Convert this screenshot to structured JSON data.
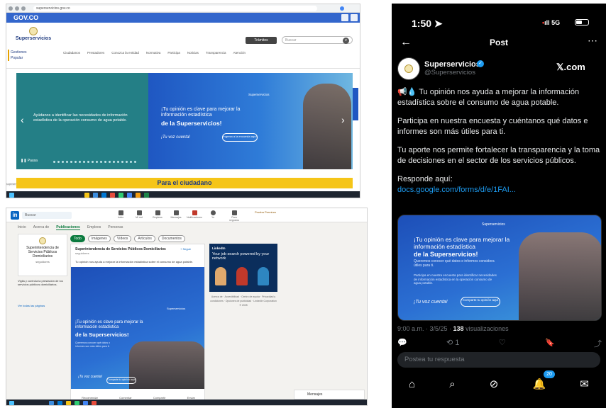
{
  "govco": {
    "url": "superservicios.gov.co",
    "topbar_logo": "GOV.CO",
    "brand": "Superservicios",
    "tramite_btn": "Trámites",
    "search_placeholder": "Buscar",
    "sidenav": [
      "Gestiones",
      "Popular"
    ],
    "menu": [
      "Ciudadanos",
      "Prestadores",
      "Conozca la entidad",
      "Normativa",
      "Participa",
      "Noticias",
      "Transparencia",
      "Atención"
    ],
    "slide_caption": "Ayúdanos a identificar las necesidades de información estadística de la operación consumo de agua potable.",
    "slide_head1": "¡Tu opinión es clave para mejorar la información estadística",
    "slide_head2": "de la Superservicios!",
    "slide_voz": "¡Tu voz cuenta!",
    "slide_pill": "Ingresa a la encuesta aquí",
    "slide_logo": "Superservicios",
    "pause": "Pausa",
    "ciudadano": "Para el ciudadano",
    "status": "superservicios.gov.co/..."
  },
  "linkedin": {
    "search": "Buscar",
    "nav": [
      "Inicio",
      "Mi red",
      "Empleos",
      "Mensajes",
      "Notificaciones",
      "Yo",
      "Para negocios"
    ],
    "premium": "Prueba Premium",
    "tabs": [
      "Inicio",
      "Acerca de",
      "Publicaciones",
      "Empleos",
      "Personas"
    ],
    "pills": [
      "Todo",
      "Imágenes",
      "Vídeos",
      "Artículos",
      "Documentos"
    ],
    "org_name": "Superintendencia de Servicios Públicos Domiciliarios",
    "org_followers": "seguidores",
    "org_desc": "Vigila y controla la prestación de los servicios públicos domiciliarios.",
    "org_link": "Ver todas las páginas",
    "post_header": "Superintendencia de Servicios Públicos Domiciliarios",
    "post_sub": "seguidores",
    "post_follow": "+ Seguir",
    "post_body": "Tu opinión nos ayuda a mejorar la información estadística sobre el consumo de agua potable.",
    "img_t1": "¡Tu opinión es clave para mejorar la información estadística",
    "img_t2": "de la Superservicios!",
    "img_t3": "Queremos conocer qué datos o informes son más útiles para ti.",
    "img_voz": "¡Tu voz cuenta!",
    "img_pill": "Comparte tu opinión aquí",
    "img_logo": "Superservicios",
    "actions": [
      "Recomendar",
      "Comentar",
      "Compartir",
      "Enviar"
    ],
    "ad_brand": "LinkedIn",
    "ad_text": "Your job search powered by your network",
    "footer": "Acerca de · Accesibilidad · Centro de ayuda · Privacidad y condiciones · Opciones de publicidad · LinkedIn Corporation © 2025",
    "messaging": "Mensajes"
  },
  "x": {
    "time": "1:50",
    "signal": "5G",
    "title": "Post",
    "user": "Superservicios",
    "handle": "@Superservicios",
    "xcom": "𝕏.com",
    "p1": "📢💧 Tu opinión nos ayuda a mejorar la información estadística sobre el consumo de agua potable.",
    "p2": "Participa en nuestra encuesta y cuéntanos qué datos e informes son más útiles para ti.",
    "p3": "Tu aporte nos permite fortalecer la transparencia y la toma de decisiones en el sector de los servicios públicos.",
    "p4_label": "Responde aquí:",
    "p4_link": "docs.google.com/forms/d/e/1FAI...",
    "media_logo": "Superservicios",
    "media_t1": "¡Tu opinión es clave para mejorar la información estadística",
    "media_t2": "de la Superservicios!",
    "media_t3": "Queremos conocer qué datos e informes considera útiles para ti.",
    "media_t4": "Participa en nuestra encuesta para identificar necesidades de información estadística en la operación consumo de agua potable.",
    "media_voz": "¡Tu voz cuenta!",
    "media_pill": "Comparte tu opinión aquí",
    "meta_time": "9:00 a.m. · 3/5/25 · ",
    "meta_views": "138",
    "meta_views_label": " visualizaciones",
    "acts": [
      "💬",
      "⟲ 1",
      "♡",
      "🔖",
      "⤴"
    ],
    "reply_placeholder": "Postea tu respuesta",
    "badge": "20",
    "tabbar": [
      "⌂",
      "⌕",
      "⊘",
      "🔔",
      "✉"
    ]
  }
}
